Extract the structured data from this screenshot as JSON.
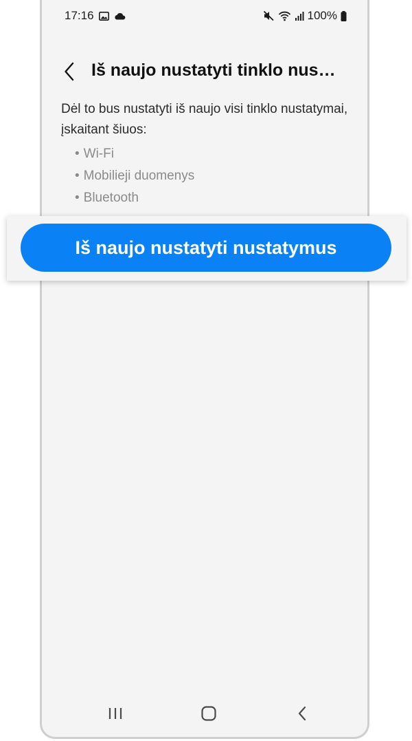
{
  "status_bar": {
    "time": "17:16",
    "battery": "100%",
    "left_icons": [
      "image-icon",
      "cloud-icon"
    ],
    "right_icons": [
      "mute-icon",
      "wifi-icon",
      "signal-icon",
      "battery-icon"
    ]
  },
  "header": {
    "title": "Iš naujo nustatyti tinklo nus…"
  },
  "content": {
    "description": "Dėl to bus nustatyti iš naujo visi tinklo nustatymai, įskaitant šiuos:",
    "items": [
      {
        "bullet": "•",
        "label": "Wi-Fi"
      },
      {
        "bullet": "•",
        "label": "Mobilieji duomenys"
      },
      {
        "bullet": "•",
        "label": "Bluetooth"
      }
    ]
  },
  "action": {
    "reset_label": "Iš naujo nustatyti nustatymus"
  },
  "navigation": {
    "buttons": [
      "recents-icon",
      "home-icon",
      "back-icon"
    ]
  },
  "colors": {
    "accent": "#0a82f5",
    "background": "#f4f4f4",
    "secondary_text": "#8a8a8a"
  }
}
